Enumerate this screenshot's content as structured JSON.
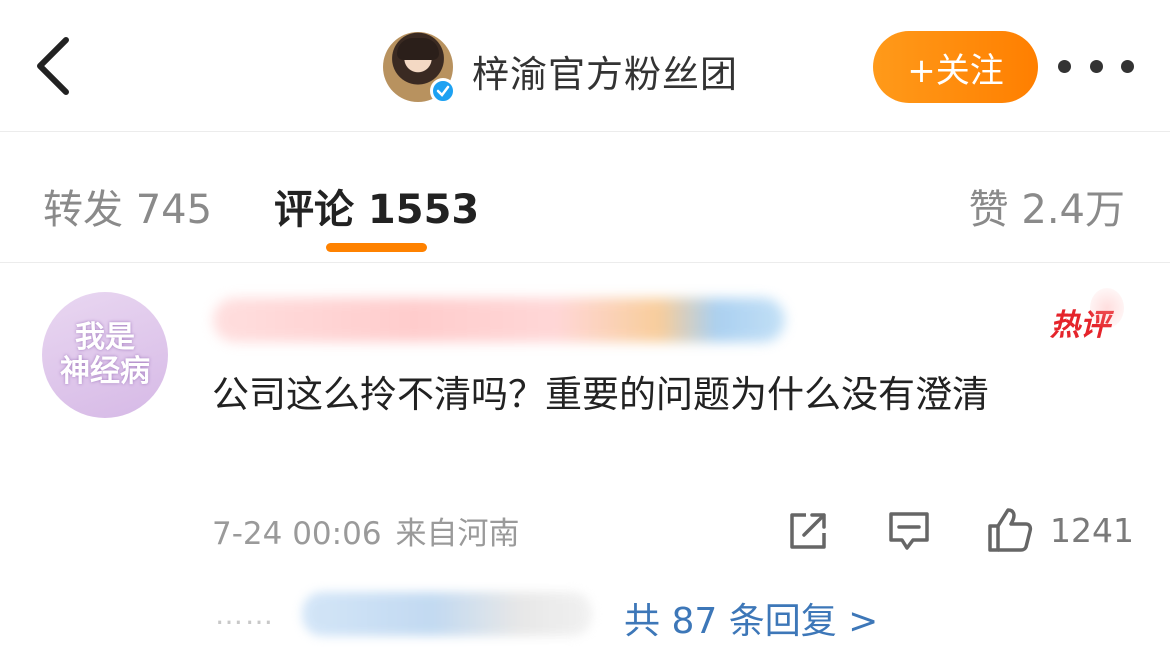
{
  "header": {
    "title": "梓渝官方粉丝团",
    "follow_label": "+关注",
    "icons": {
      "back": "chevron-left-icon",
      "verified": "verified-badge-icon",
      "more": "more-dots-icon"
    },
    "colors": {
      "follow_button": "#ff8200",
      "verified": "#1da1f2"
    }
  },
  "tabs": {
    "repost": "转发 745",
    "comment": "评论 1553",
    "like": "赞 2.4万",
    "active": "comment",
    "indicator_color": "#ff8200"
  },
  "comment": {
    "avatar_text_line1": "我是",
    "avatar_text_line2": "神经病",
    "hot_badge": "热评",
    "text": "公司这么拎不清吗？重要的问题为什么没有澄清",
    "date": "7-24 00:06",
    "location": "来自河南",
    "like_count": "1241",
    "icons": {
      "share": "share-icon",
      "reply": "comment-icon",
      "like": "thumbs-up-icon"
    },
    "hot_badge_color": "#e5242b"
  },
  "replies": {
    "dots": "……",
    "summary": "共 87 条回复 >",
    "link_color": "#3d77b8"
  }
}
